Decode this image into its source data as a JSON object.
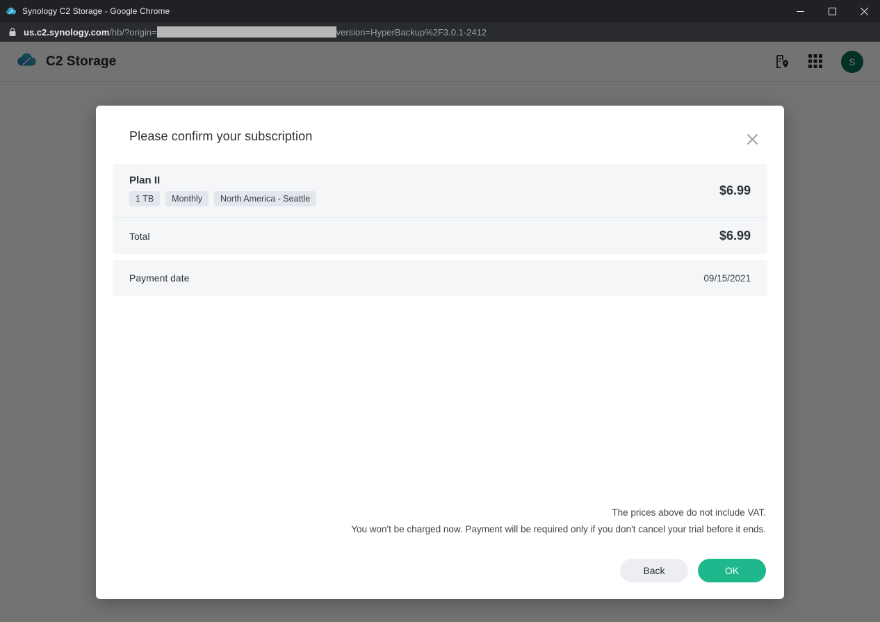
{
  "browser": {
    "tab_title": "Synology C2 Storage - Google Chrome",
    "favicon": "synology-cloud-icon",
    "window_controls": {
      "minimize": "minimize-icon",
      "maximize": "maximize-icon",
      "close": "close-icon"
    },
    "url": {
      "lock": "lock-icon",
      "host": "us.c2.synology.com",
      "path_before_redaction": "/hb/?origin=",
      "redacted": "",
      "path_after_redaction": "version=HyperBackup%2F3.0.1-2412"
    }
  },
  "app_header": {
    "logo": "c2-cloud-logo",
    "brand": "C2 Storage",
    "icons": {
      "region_doc": "document-location-icon",
      "app_launcher": "grid-apps-icon"
    },
    "avatar_initial": "S"
  },
  "modal": {
    "title": "Please confirm your subscription",
    "close_icon": "close-icon",
    "plan": {
      "name": "Plan II",
      "tags": [
        "1 TB",
        "Monthly",
        "North America - Seattle"
      ],
      "price": "$6.99"
    },
    "total": {
      "label": "Total",
      "value": "$6.99"
    },
    "payment_date": {
      "label": "Payment date",
      "value": "09/15/2021"
    },
    "notes": [
      "The prices above do not include VAT.",
      "You won't be charged now. Payment will be required only if you don't cancel your trial before it ends."
    ],
    "buttons": {
      "back": "Back",
      "ok": "OK"
    }
  },
  "colors": {
    "accent_green": "#1fb78c",
    "avatar_green": "#0b6e54",
    "card_bg": "#f4f6f8",
    "tag_bg": "#e3e6ec",
    "text_primary": "#2e3338"
  }
}
